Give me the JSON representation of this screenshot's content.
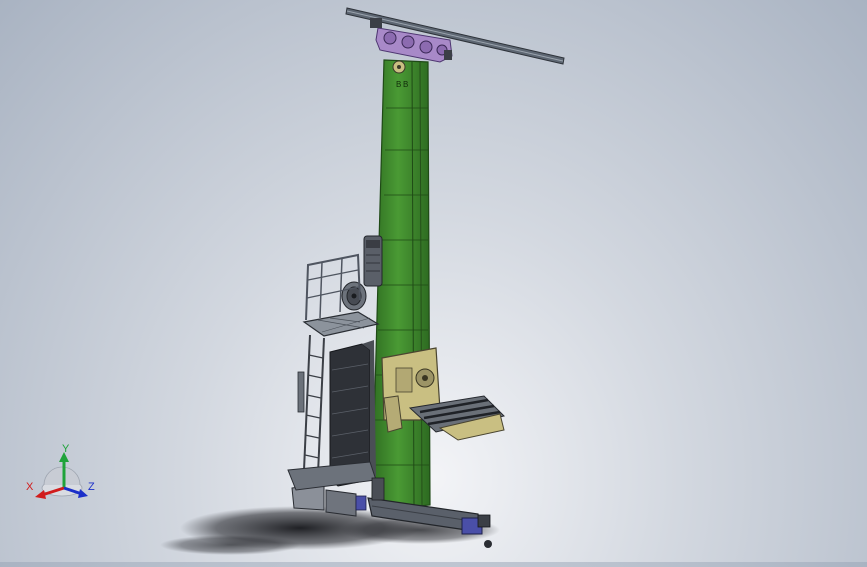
{
  "viewport": {
    "background_top": "#a9b3c2",
    "background_center": "#f3f4f7"
  },
  "model": {
    "colors": {
      "mast": "#3f8a2c",
      "mast_dark": "#2c6620",
      "rail": "#5d6672",
      "carriage": "#a889c8",
      "fork_frame": "#c9bf82",
      "platform": "#8c939c",
      "dark_steel": "#3b3f46",
      "shadow": "#1e1f22",
      "accent_blue": "#4a4fa8"
    },
    "mast_plate_labels": [
      "B",
      "B"
    ]
  },
  "triad": {
    "x_label": "X",
    "y_label": "Y",
    "z_label": "Z",
    "x_color": "#d11c1c",
    "y_color": "#1fa33a",
    "z_color": "#1b2fc9"
  }
}
